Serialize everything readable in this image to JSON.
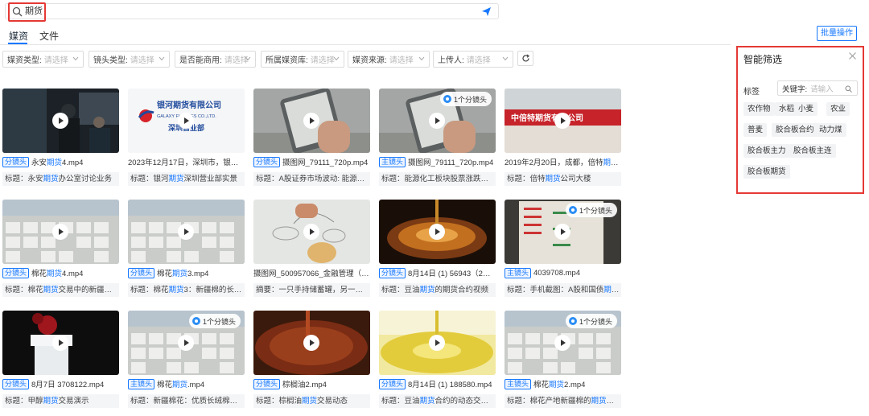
{
  "search": {
    "query": "期货"
  },
  "tabs": [
    {
      "label": "媒资",
      "active": true
    },
    {
      "label": "文件",
      "active": false
    }
  ],
  "batch_button": "批量操作",
  "filters": [
    {
      "label": "媒资类型:",
      "placeholder": "请选择"
    },
    {
      "label": "镜头类型:",
      "placeholder": "请选择"
    },
    {
      "label": "是否能商用:",
      "placeholder": "请选择"
    },
    {
      "label": "所属媒资库:",
      "placeholder": "请选择"
    },
    {
      "label": "媒资来源:",
      "placeholder": "请选择"
    },
    {
      "label": "上传人:",
      "placeholder": "请选择"
    }
  ],
  "colors": {
    "accent": "#1677ff",
    "highlight_border": "#e53935"
  },
  "smart_filter": {
    "title": "智能筛选",
    "tag_label": "标签",
    "keyword_label": "关键字:",
    "keyword_placeholder": "请输入",
    "chips": [
      "农作物",
      "水稻",
      "小麦",
      "农业",
      "普麦",
      "胶合板合约",
      "动力煤",
      "胶合板主力",
      "胶合板主连",
      "胶合板期货"
    ]
  },
  "cards": [
    {
      "tag": "分镜头",
      "badge": "",
      "fname_pre": "永安",
      "fname_kw": "期货",
      "fname_post": "4.mp4",
      "desc_pre": "标题：永安",
      "desc_kw": "期货",
      "desc_post": "办公室讨论业务",
      "thumb": "office"
    },
    {
      "tag": "",
      "badge": "",
      "fname_pre": "2023年12月17日，深圳市，银河",
      "fname_kw": "期货",
      "fname_post": "",
      "desc_pre": "标题：银河",
      "desc_kw": "期货",
      "desc_post": "深圳营业部实景",
      "thumb": "galaxy",
      "logo_main": "银河期货有限公司",
      "logo_en": "GALAXY FUTURES CO.,LTD.",
      "logo_sub": "深圳营业部"
    },
    {
      "tag": "分镜头",
      "badge": "",
      "fname_pre": "摄图网_79111_720p.mp4",
      "fname_kw": "",
      "fname_post": "",
      "desc_pre": "标题：A股证券市场波动: 能源",
      "desc_kw": "期货",
      "desc_post": "",
      "thumb": "phone"
    },
    {
      "tag": "主镜头",
      "badge": "1个分镜头",
      "fname_pre": "摄图网_79111_720p.mp4",
      "fname_kw": "",
      "fname_post": "",
      "desc_pre": "标题：能源化工板块股票涨跌情况: ",
      "desc_kw": "",
      "desc_post": "",
      "thumb": "phone"
    },
    {
      "tag": "",
      "badge": "",
      "fname_pre": "2019年2月20日，成都，倍特",
      "fname_kw": "期货",
      "fname_post": "（...",
      "desc_pre": "标题：倍特",
      "desc_kw": "期货",
      "desc_post": "公司大楼",
      "thumb": "building",
      "sign": "中倍特期货有限公司"
    },
    {
      "tag": "分镜头",
      "badge": "",
      "fname_pre": "棉花",
      "fname_kw": "期货",
      "fname_post": "4.mp4",
      "desc_pre": "标题：棉花",
      "desc_kw": "期货",
      "desc_post": "交易中的新疆棉优势",
      "thumb": "cotton"
    },
    {
      "tag": "分镜头",
      "badge": "",
      "fname_pre": "棉花",
      "fname_kw": "期货",
      "fname_post": "3.mp4",
      "desc_pre": "标题：棉花",
      "desc_kw": "期货",
      "desc_post": "3：新疆棉的长绒棉...",
      "thumb": "cotton"
    },
    {
      "tag": "",
      "badge": "",
      "fname_pre": "摄图网_500957066_金融管理（企业...",
      "fname_kw": "",
      "fname_post": "",
      "desc_pre": "摘要：一只手持储蓄罐，另一手持币...",
      "desc_kw": "",
      "desc_post": "",
      "thumb": "piggy"
    },
    {
      "tag": "分镜头",
      "badge": "",
      "fname_pre": "8月14日 (1) 56943（2）.mp4",
      "fname_kw": "",
      "fname_post": "",
      "desc_pre": "标题：豆油",
      "desc_kw": "期货",
      "desc_post": "的期货合约视频",
      "thumb": "oil"
    },
    {
      "tag": "主镜头",
      "badge": "1个分镜头",
      "fname_pre": "4039708.mp4",
      "fname_kw": "",
      "fname_post": "",
      "desc_pre": "标题：手机截图：A股和国债",
      "desc_kw": "期货",
      "desc_post": "的...",
      "thumb": "screen"
    },
    {
      "tag": "分镜头",
      "badge": "",
      "fname_pre": "8月7日 3708122.mp4",
      "fname_kw": "",
      "fname_post": "",
      "desc_pre": "标题：甲醇",
      "desc_kw": "期货",
      "desc_post": "交易演示",
      "thumb": "chem"
    },
    {
      "tag": "主镜头",
      "badge": "1个分镜头",
      "fname_pre": "棉花",
      "fname_kw": "期货",
      "fname_post": ".mp4",
      "desc_pre": "标题：新疆棉花：优质长绒棉的",
      "desc_kw": "期货",
      "desc_post": "...",
      "thumb": "cotton"
    },
    {
      "tag": "分镜头",
      "badge": "",
      "fname_pre": "棕榈油2.mp4",
      "fname_kw": "",
      "fname_post": "",
      "desc_pre": "标题：棕榈油",
      "desc_kw": "期货",
      "desc_post": "交易动态",
      "thumb": "palm"
    },
    {
      "tag": "分镜头",
      "badge": "",
      "fname_pre": "8月14日 (1) 188580.mp4",
      "fname_kw": "",
      "fname_post": "",
      "desc_pre": "标题：豆油",
      "desc_kw": "期货",
      "desc_post": "合约的动态交易过程",
      "thumb": "yellowoil"
    },
    {
      "tag": "主镜头",
      "badge": "1个分镜头",
      "fname_pre": "棉花",
      "fname_kw": "期货",
      "fname_post": "2.mp4",
      "desc_pre": "标题：棉花产地新疆棉的",
      "desc_kw": "期货",
      "desc_post": "交易现...",
      "thumb": "cotton"
    }
  ]
}
